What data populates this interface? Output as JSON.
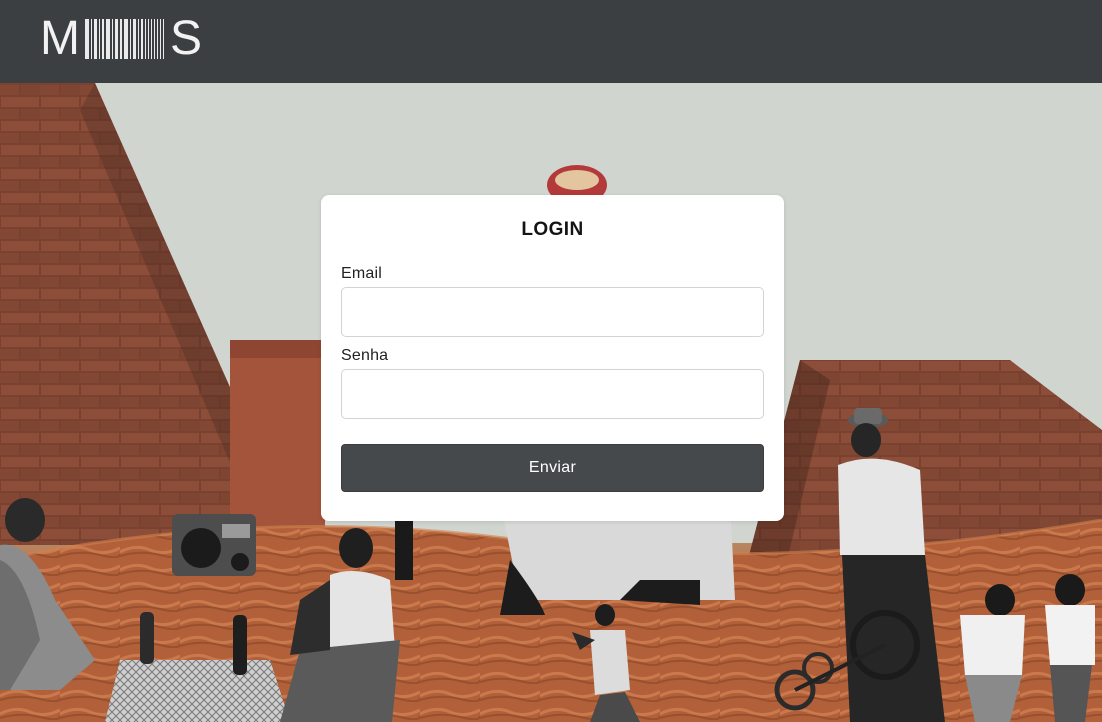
{
  "header": {
    "logo": {
      "first_letter": "M",
      "last_letter": "S"
    }
  },
  "login": {
    "title": "LOGIN",
    "email_label": "Email",
    "email_value": "",
    "password_label": "Senha",
    "password_value": "",
    "submit_label": "Enviar"
  },
  "colors": {
    "topbar": "#3c3f42",
    "button": "#46494c",
    "card": "#ffffff",
    "sand": "#b4623a"
  },
  "background": {
    "icon": "desert-pyramids-collage-image"
  }
}
